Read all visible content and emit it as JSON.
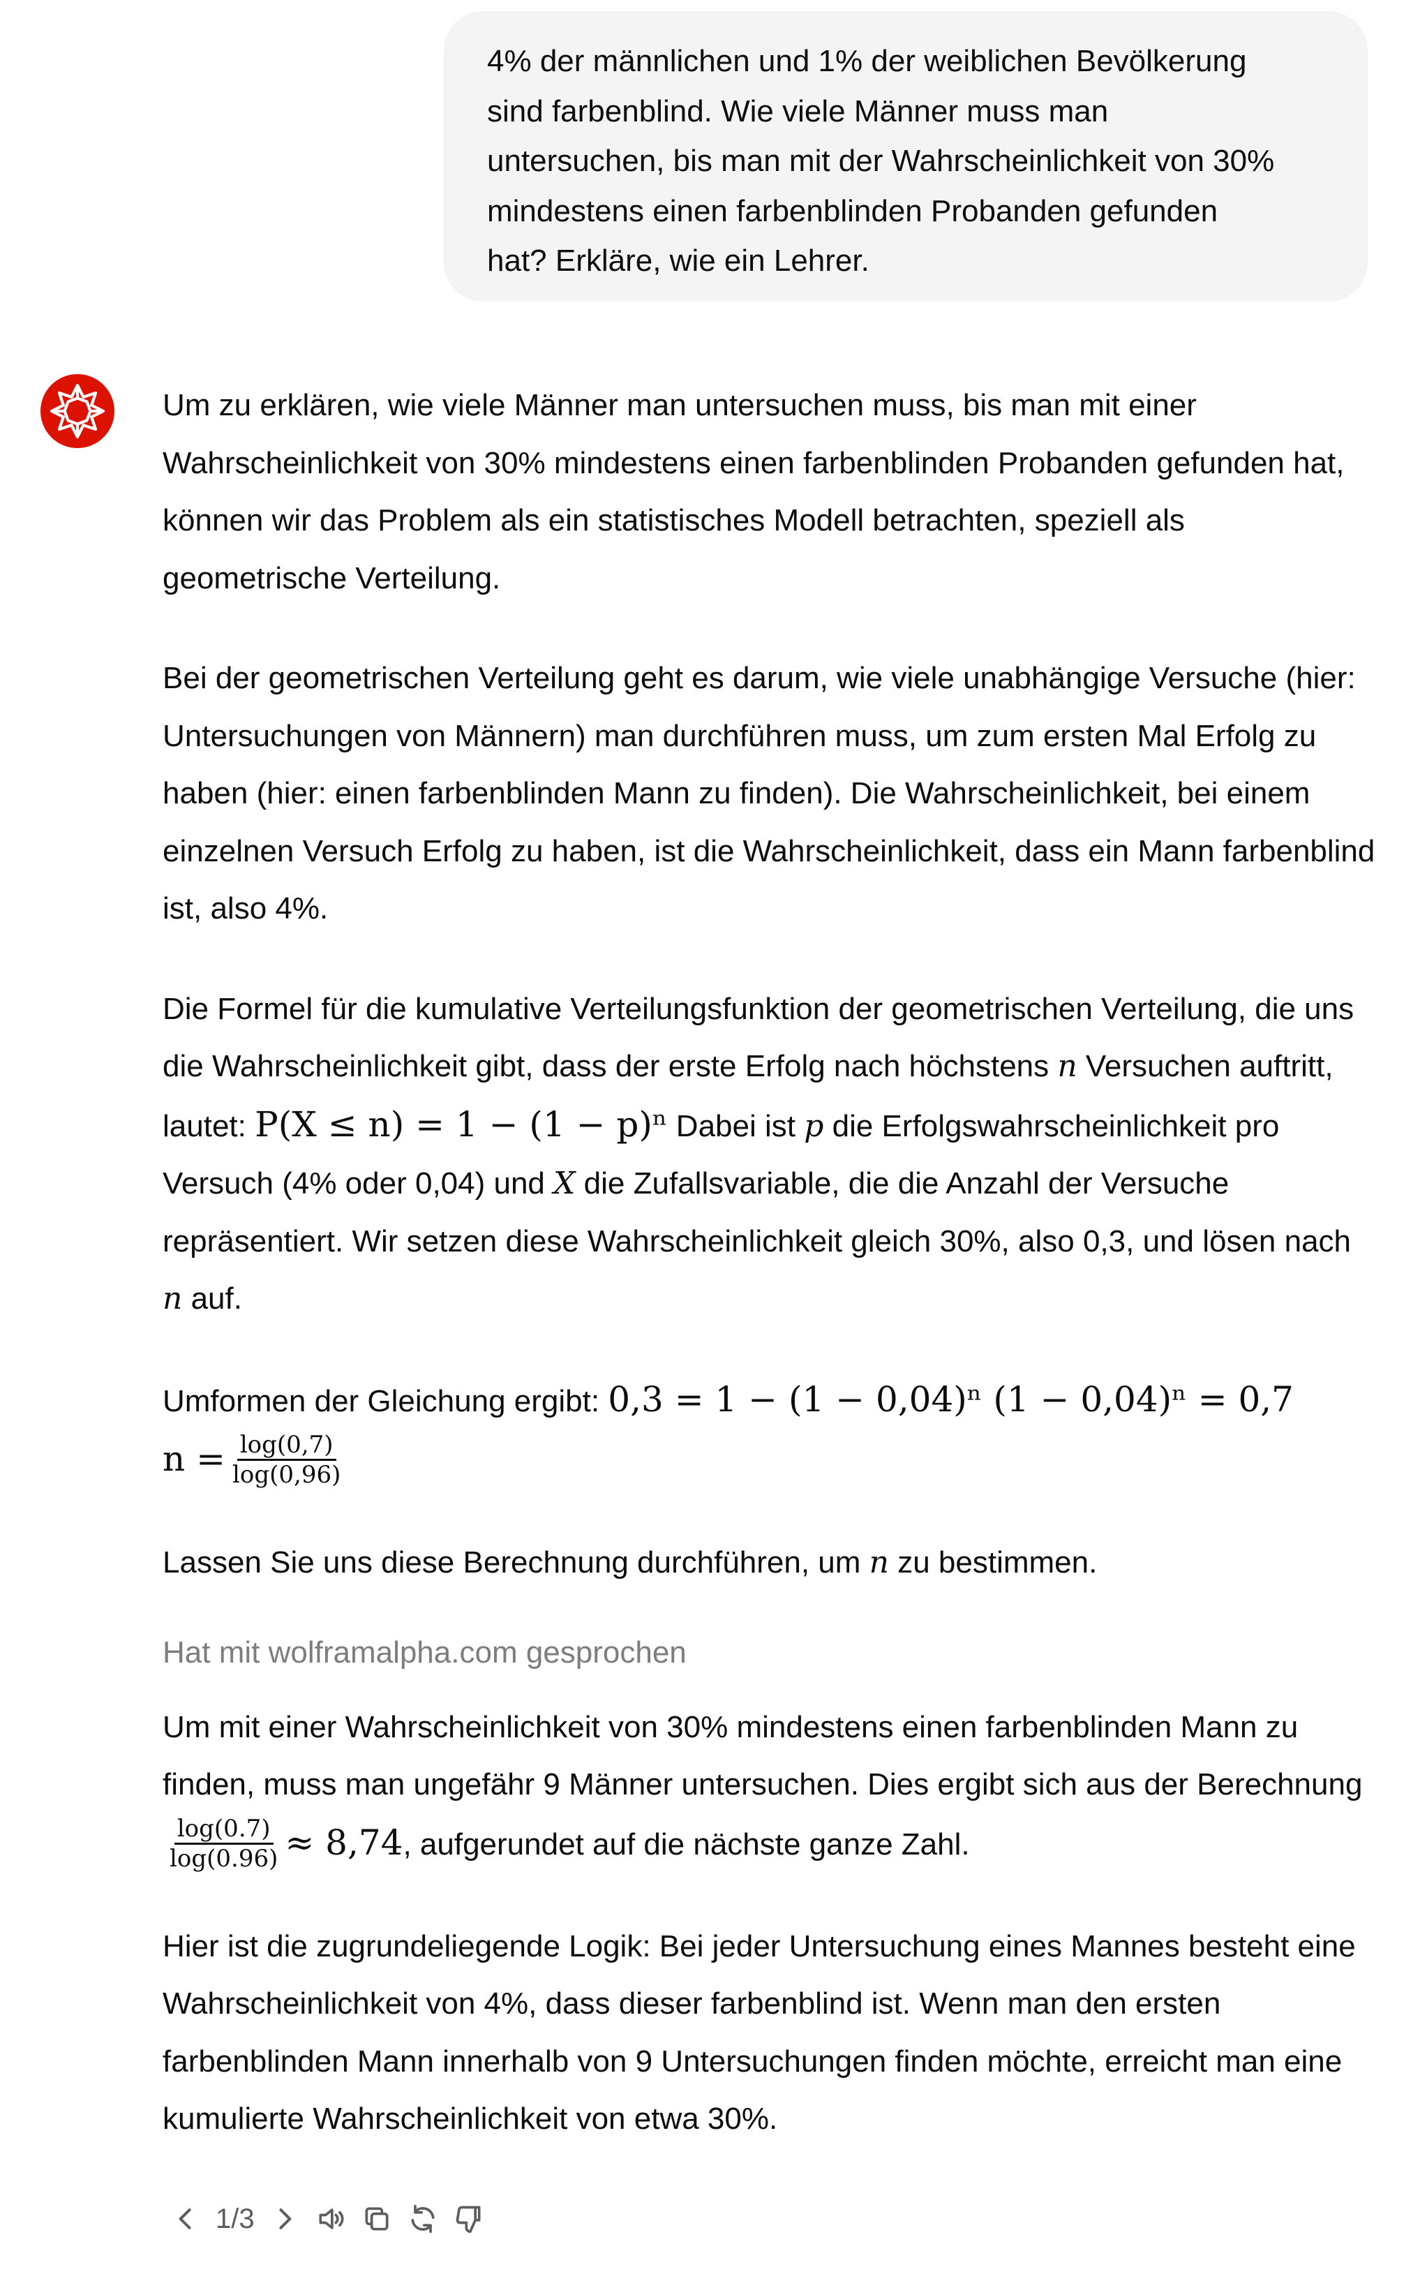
{
  "user_message": {
    "lines": [
      "4% der männlichen und 1% der weiblichen Bevölkerung",
      "sind farbenblind. Wie viele Männer muss man",
      "untersuchen, bis man mit der Wahrscheinlichkeit von 30%",
      "mindestens einen farbenblinden Probanden gefunden",
      "hat? Erkläre, wie ein Lehrer."
    ]
  },
  "assistant": {
    "avatar_icon": "wolfram-spikey-icon",
    "accent_color": "#dd1100",
    "p1": "Um zu erklären, wie viele Männer man untersuchen muss, bis man mit einer Wahrscheinlichkeit von 30% mindestens einen farbenblinden Probanden gefunden hat, können wir das Problem als ein statistisches Modell betrachten, speziell als geometrische Verteilung.",
    "p2": "Bei der geometrischen Verteilung geht es darum, wie viele unabhängige Versuche (hier: Untersuchungen von Männern) man durchführen muss, um zum ersten Mal Erfolg zu haben (hier: einen farbenblinden Mann zu finden). Die Wahrscheinlichkeit, bei einem einzelnen Versuch Erfolg zu haben, ist die Wahrscheinlichkeit, dass ein Mann farbenblind ist, also 4%.",
    "p3": {
      "t1": "Die Formel für die kumulative Verteilungsfunktion der geometrischen Verteilung, die uns die Wahrscheinlichkeit gibt, dass der erste Erfolg nach höchstens ",
      "m1": "n",
      "t2": " Versuchen auftritt, lautet: ",
      "m2": "P(X ≤ n) = 1 − (1 − p)ⁿ",
      "t3": " Dabei ist ",
      "m3": "p",
      "t4": " die Erfolgswahrscheinlichkeit pro Versuch (4% oder 0,04) und ",
      "m4": "X",
      "t5": " die Zufallsvariable, die die Anzahl der Versuche repräsentiert. Wir setzen diese Wahrscheinlichkeit gleich 30%, also 0,3, und lösen nach ",
      "m5": "n",
      "t6": " auf."
    },
    "p4": {
      "t1": "Umformen der Gleichung ergibt: ",
      "eq1": "0,3 = 1 − (1 − 0,04)ⁿ (1 − 0,04)ⁿ = 0,7",
      "eq2_lhs": "n =",
      "frac_num": "log(0,7)",
      "frac_den": "log(0,96)"
    },
    "p5": {
      "t1": "Lassen Sie uns diese Berechnung durchführen, um ",
      "m1": "n",
      "t2": " zu bestimmen."
    },
    "tool_note": "Hat mit wolframalpha.com gesprochen",
    "p6": {
      "t1": "Um mit einer Wahrscheinlichkeit von 30% mindestens einen farbenblinden Mann zu finden, muss man ungefähr 9 Männer untersuchen. Dies ergibt sich aus der Berechnung ",
      "frac_num": "log(0.7)",
      "frac_den": "log(0.96)",
      "approx": "≈ 8,74",
      "t2": ", aufgerundet auf die nächste ganze Zahl."
    },
    "p7": "Hier ist die zugrundeliegende Logik: Bei jeder Untersuchung eines Mannes besteht eine Wahrscheinlichkeit von 4%, dass dieser farbenblind ist. Wenn man den ersten farbenblinden Mann innerhalb von 9 Untersuchungen finden möchte, erreicht man eine kumulierte Wahrscheinlichkeit von etwa 30%."
  },
  "actions": {
    "pager": "1/3",
    "icons": [
      "chevron-left-icon",
      "chevron-right-icon",
      "read-aloud-icon",
      "copy-icon",
      "regenerate-icon",
      "thumbs-down-icon"
    ]
  }
}
